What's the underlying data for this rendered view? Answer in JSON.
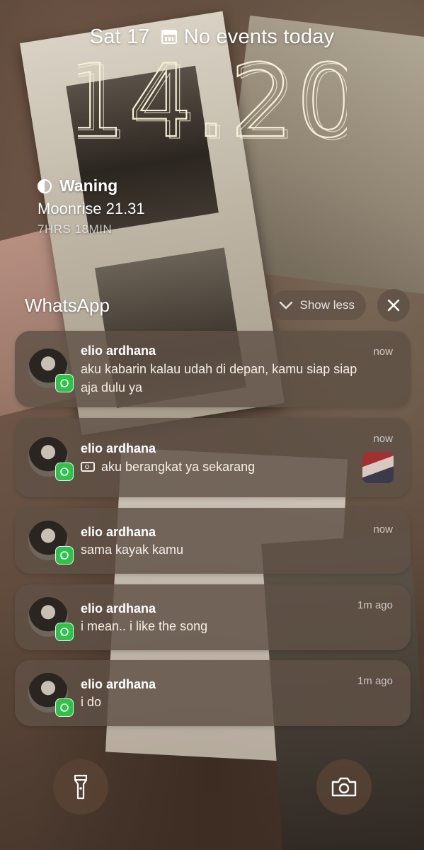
{
  "status": {
    "date": "Sat 17",
    "events": "No events today",
    "time": "14.20"
  },
  "widget": {
    "phase": "Waning",
    "moonrise": "Moonrise 21.31",
    "countdown": "7HRS 18MIN"
  },
  "notification_group": {
    "app_name": "WhatsApp",
    "show_less_label": "Show less"
  },
  "notifications": [
    {
      "sender": "elio ardhana",
      "time": "now",
      "message": "aku kabarin kalau udah di depan, kamu siap siap aja dulu ya"
    },
    {
      "sender": "elio ardhana",
      "time": "now",
      "message": "aku berangkat ya sekarang",
      "attachment": "photo"
    },
    {
      "sender": "elio ardhana",
      "time": "now",
      "message": "sama kayak kamu"
    },
    {
      "sender": "elio ardhana",
      "time": "1m ago",
      "message": "i mean.. i like the song"
    },
    {
      "sender": "elio ardhana",
      "time": "1m ago",
      "message": "i do"
    }
  ],
  "icons": {
    "calendar": "calendar-icon",
    "moon": "waning-moon-icon",
    "chevron": "chevron-down-icon",
    "close": "close-icon",
    "app": "whatsapp-icon",
    "flashlight": "flashlight-icon",
    "camera": "camera-icon"
  },
  "colors": {
    "notification_bg": "#5f5046",
    "whatsapp_green": "#2fc24a",
    "clock_color": "#f7f0d8"
  }
}
